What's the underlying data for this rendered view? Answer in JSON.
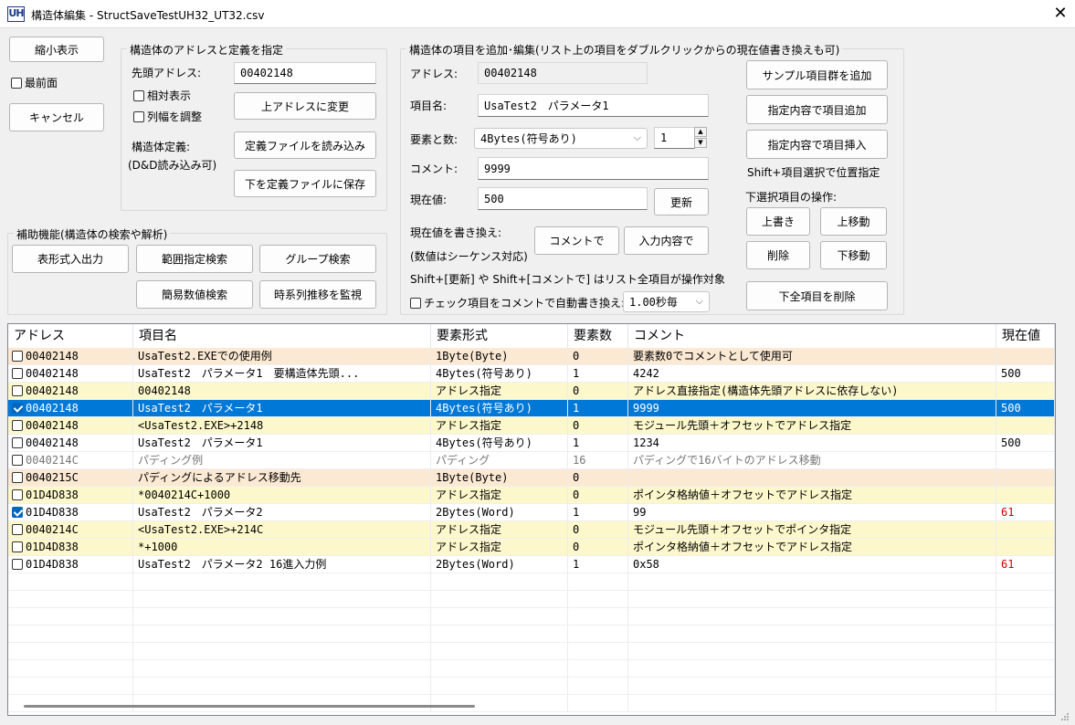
{
  "window": {
    "title": "構造体編集 - StructSaveTestUH32_UT32.csv",
    "icon_text": "UH"
  },
  "left": {
    "shrink_button": "縮小表示",
    "topmost_label": "最前面",
    "cancel_button": "キャンセル"
  },
  "addr_group": {
    "title": "構造体のアドレスと定義を指定",
    "start_addr_label": "先頭アドレス:",
    "start_addr_value": "00402148",
    "relative_label": "相対表示",
    "colwidth_label": "列幅を調整",
    "upper_addr_button": "上アドレスに変更",
    "def_label": "構造体定義:",
    "dnd_label": "(D&D読み込み可)",
    "load_button": "定義ファイルを読み込み",
    "save_button": "下を定義ファイルに保存"
  },
  "aux_group": {
    "title": "補助機能(構造体の検索や解析)",
    "table_io_button": "表形式入出力",
    "range_search_button": "範囲指定検索",
    "group_search_button": "グループ検索",
    "simple_search_button": "簡易数値検索",
    "monitor_button": "時系列推移を監視"
  },
  "edit_group": {
    "title": "構造体の項目を追加･編集(リスト上の項目をダブルクリックからの現在値書き換えも可)",
    "address_label": "アドレス:",
    "address_value": "00402148",
    "name_label": "項目名:",
    "name_value": "UsaTest2　パラメータ1",
    "elem_label": "要素と数:",
    "elem_type": "4Bytes(符号あり)",
    "elem_count": "1",
    "comment_label": "コメント:",
    "comment_value": "9999",
    "current_label": "現在値:",
    "current_value": "500",
    "update_button": "更新",
    "rewrite_label": "現在値を書き換え:",
    "rewrite_note": "(数値はシーケンス対応)",
    "by_comment_button": "コメントで",
    "by_input_button": "入力内容で",
    "shift_note": "Shift+[更新] や Shift+[コメントで] はリスト全項目が操作対象",
    "auto_rewrite_label": "チェック項目をコメントで自動書き換え:",
    "interval_value": "1.00秒毎",
    "add_sample_button": "サンプル項目群を追加",
    "add_item_button": "指定内容で項目追加",
    "insert_item_button": "指定内容で項目挿入",
    "shift_select_note": "Shift+項目選択で位置指定",
    "ops_label": "下選択項目の操作:",
    "overwrite_button": "上書き",
    "move_up_button": "上移動",
    "delete_button": "削除",
    "move_down_button": "下移動",
    "delete_all_button": "下全項目を削除"
  },
  "table": {
    "columns": [
      "アドレス",
      "項目名",
      "要素形式",
      "要素数",
      "コメント",
      "現在値"
    ],
    "rows": [
      {
        "checked": false,
        "addr": "00402148",
        "name": "UsaTest2.EXEでの使用例",
        "type": "1Byte(Byte)",
        "count": "0",
        "comment": "要素数0でコメントとして使用可",
        "value": "",
        "style": "orange"
      },
      {
        "checked": false,
        "addr": "00402148",
        "name": "UsaTest2　パラメータ1　要構造体先頭...",
        "type": "4Bytes(符号あり)",
        "count": "1",
        "comment": "4242",
        "value": "500",
        "style": "white"
      },
      {
        "checked": false,
        "addr": "00402148",
        "name": "00402148",
        "type": "アドレス指定",
        "count": "0",
        "comment": "アドレス直接指定(構造体先頭アドレスに依存しない)",
        "value": "",
        "style": "yellow"
      },
      {
        "checked": true,
        "addr": "00402148",
        "name": "UsaTest2　パラメータ1",
        "type": "4Bytes(符号あり)",
        "count": "1",
        "comment": "9999",
        "value": "500",
        "style": "selected"
      },
      {
        "checked": false,
        "addr": "00402148",
        "name": "<UsaTest2.EXE>+2148",
        "type": "アドレス指定",
        "count": "0",
        "comment": "モジュール先頭＋オフセットでアドレス指定",
        "value": "",
        "style": "yellow"
      },
      {
        "checked": false,
        "addr": "00402148",
        "name": "UsaTest2　パラメータ1",
        "type": "4Bytes(符号あり)",
        "count": "1",
        "comment": "1234",
        "value": "500",
        "style": "white"
      },
      {
        "checked": false,
        "addr": "0040214C",
        "name": "パディング例",
        "type": "パディング",
        "count": "16",
        "comment": "パディングで16バイトのアドレス移動",
        "value": "",
        "style": "gray"
      },
      {
        "checked": false,
        "addr": "0040215C",
        "name": "パディングによるアドレス移動先",
        "type": "1Byte(Byte)",
        "count": "0",
        "comment": "",
        "value": "",
        "style": "orange"
      },
      {
        "checked": false,
        "addr": "01D4D838",
        "name": "*0040214C+1000",
        "type": "アドレス指定",
        "count": "0",
        "comment": "ポインタ格納値＋オフセットでアドレス指定",
        "value": "",
        "style": "yellow"
      },
      {
        "checked": true,
        "addr": "01D4D838",
        "name": "UsaTest2　パラメータ2",
        "type": "2Bytes(Word)",
        "count": "1",
        "comment": "99",
        "value": "61",
        "style": "white",
        "value_red": true
      },
      {
        "checked": false,
        "addr": "0040214C",
        "name": "<UsaTest2.EXE>+214C",
        "type": "アドレス指定",
        "count": "0",
        "comment": "モジュール先頭＋オフセットでポインタ指定",
        "value": "",
        "style": "yellow"
      },
      {
        "checked": false,
        "addr": "01D4D838",
        "name": "*+1000",
        "type": "アドレス指定",
        "count": "0",
        "comment": "ポインタ格納値＋オフセットでアドレス指定",
        "value": "",
        "style": "yellow"
      },
      {
        "checked": false,
        "addr": "01D4D838",
        "name": "UsaTest2　パラメータ2 16進入力例",
        "type": "2Bytes(Word)",
        "count": "1",
        "comment": "0x58",
        "value": "61",
        "style": "white",
        "value_red": true
      }
    ]
  },
  "icons": {
    "close": "close-icon",
    "chevron": "chevron-down-icon"
  }
}
